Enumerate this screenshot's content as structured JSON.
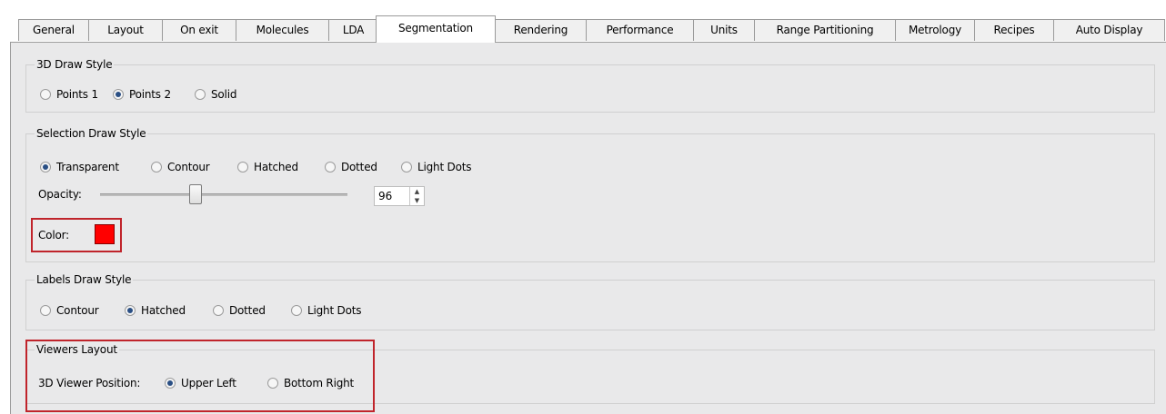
{
  "tabs": [
    {
      "label": "General"
    },
    {
      "label": "Layout"
    },
    {
      "label": "On exit"
    },
    {
      "label": "Molecules"
    },
    {
      "label": "LDA"
    },
    {
      "label": "Segmentation"
    },
    {
      "label": "Rendering"
    },
    {
      "label": "Performance"
    },
    {
      "label": "Units"
    },
    {
      "label": "Range Partitioning"
    },
    {
      "label": "Metrology"
    },
    {
      "label": "Recipes"
    },
    {
      "label": "Auto Display"
    }
  ],
  "active_tab": "Segmentation",
  "draw_style": {
    "title": "3D Draw Style",
    "options": [
      {
        "label": "Points 1",
        "checked": false
      },
      {
        "label": "Points 2",
        "checked": true
      },
      {
        "label": "Solid",
        "checked": false
      }
    ]
  },
  "selection_style": {
    "title": "Selection Draw Style",
    "options": [
      {
        "label": "Transparent",
        "checked": true
      },
      {
        "label": "Contour",
        "checked": false
      },
      {
        "label": "Hatched",
        "checked": false
      },
      {
        "label": "Dotted",
        "checked": false
      },
      {
        "label": "Light Dots",
        "checked": false
      }
    ],
    "opacity_label": "Opacity:",
    "opacity_value": "96",
    "color_label": "Color:",
    "color": "#ff0000"
  },
  "labels_style": {
    "title": "Labels  Draw Style",
    "options": [
      {
        "label": "Contour",
        "checked": false
      },
      {
        "label": "Hatched",
        "checked": true
      },
      {
        "label": "Dotted",
        "checked": false
      },
      {
        "label": "Light Dots",
        "checked": false
      }
    ]
  },
  "viewers_layout": {
    "title": "Viewers Layout",
    "position_label": "3D Viewer Position:",
    "options": [
      {
        "label": "Upper Left",
        "checked": true
      },
      {
        "label": "Bottom Right",
        "checked": false
      }
    ]
  },
  "highlight_color": "#c0242b"
}
